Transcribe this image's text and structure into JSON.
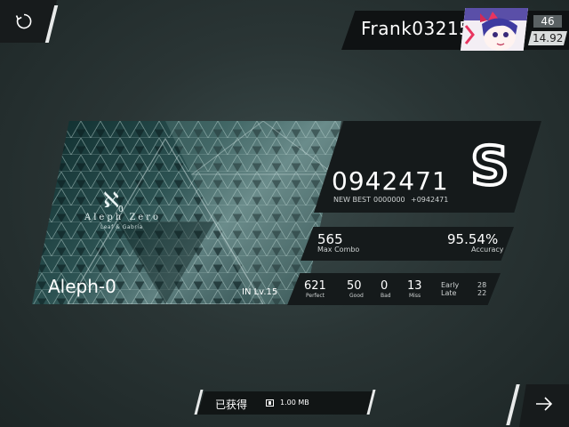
{
  "player": {
    "name": "Frank03215",
    "rank": "46",
    "rks": "14.92"
  },
  "song": {
    "name": "Aleph-0",
    "difficulty": "IN  Lv.15",
    "art_title": "Aleph Zero",
    "art_subtitle": "Leaf & Gabria",
    "art_glyph": "ℵ0"
  },
  "result": {
    "score": "0942471",
    "new_best_label": "NEW BEST",
    "previous_best": "0000000",
    "delta": "+0942471",
    "grade": "S"
  },
  "stats": {
    "max_combo": "565",
    "max_combo_label": "Max Combo",
    "accuracy": "95.54%",
    "accuracy_label": "Accuracy"
  },
  "judgements": {
    "perfect": "621",
    "perfect_label": "Perfect",
    "good": "50",
    "good_label": "Good",
    "bad": "0",
    "bad_label": "Bad",
    "miss": "13",
    "miss_label": "Miss",
    "early_label": "Early",
    "early": "28",
    "late_label": "Late",
    "late": "22"
  },
  "reward": {
    "label": "已获得",
    "size": "1.00 MB"
  },
  "icons": {
    "retry": "retry-icon",
    "next": "arrow-right-icon",
    "reward": "data-icon"
  },
  "colors": {
    "panel": "#151a1b",
    "accent": "#ffffff"
  }
}
